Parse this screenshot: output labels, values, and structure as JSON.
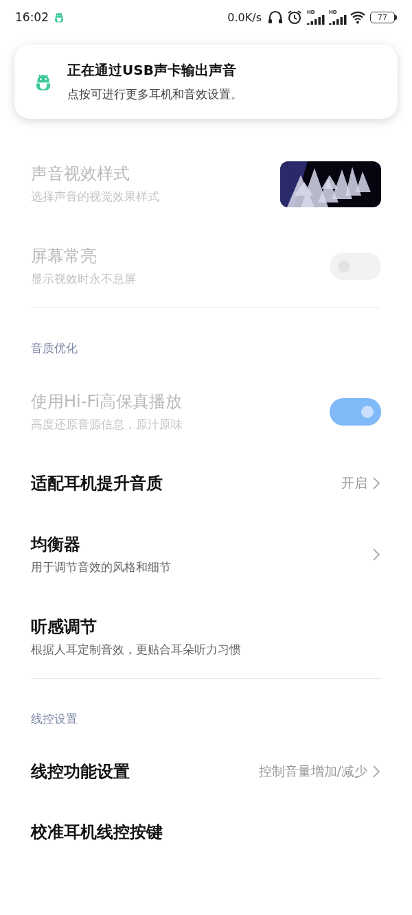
{
  "status_bar": {
    "time": "16:02",
    "net_speed": "0.0K/s",
    "signals": [
      {
        "label": "HD"
      },
      {
        "label": "HD"
      }
    ],
    "battery": "77"
  },
  "notification": {
    "title": "正在通过USB声卡输出声音",
    "text": "点按可进行更多耳机和音效设置。"
  },
  "sections": [
    {
      "items": [
        {
          "title": "声音视效样式",
          "subtitle": "选择声音的视觉效果样式",
          "disabled": true
        },
        {
          "kind": "toggle",
          "title": "屏幕常亮",
          "subtitle": "显示视效时永不息屏",
          "disabled": true,
          "on": false
        }
      ]
    },
    {
      "header": "音质优化",
      "items": [
        {
          "kind": "toggle",
          "title": "使用Hi-Fi高保真播放",
          "subtitle": "高度还原音源信息，原汁原味",
          "disabled": true,
          "on": true
        },
        {
          "kind": "nav",
          "title": "适配耳机提升音质",
          "value": "开启",
          "disabled": false
        },
        {
          "kind": "nav",
          "title": "均衡器",
          "subtitle": "用于调节音效的风格和细节",
          "disabled": false
        },
        {
          "kind": "plain",
          "title": "听感调节",
          "subtitle": "根据人耳定制音效，更贴合耳朵听力习惯",
          "disabled": false
        }
      ]
    },
    {
      "header": "线控设置",
      "items": [
        {
          "kind": "nav",
          "title": "线控功能设置",
          "value": "控制音量增加/减少",
          "disabled": false
        },
        {
          "kind": "plain",
          "title": "校准耳机线控按键",
          "disabled": false
        }
      ]
    }
  ]
}
